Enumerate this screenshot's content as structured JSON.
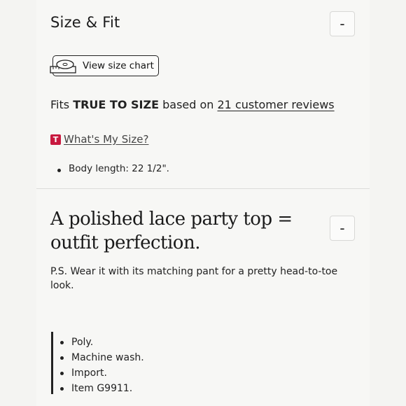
{
  "size_fit": {
    "title": "Size & Fit",
    "toggle_symbol": "-",
    "size_chart_label": "View size chart",
    "fits_prefix": "Fits ",
    "fits_value": "TRUE TO SIZE",
    "fits_middle": " based on ",
    "reviews_link": "21 customer reviews",
    "whats_my_size_badge": "T",
    "whats_my_size_label": "What's My Size?",
    "measurements": [
      "Body length: 22 1/2\"."
    ]
  },
  "details": {
    "headline": "A polished lace party top = outfit perfection.",
    "toggle_symbol": "-",
    "ps_text": "P.S. Wear it with its matching pant for a pretty head-to-toe look.",
    "features": [
      "Poly.",
      "Machine wash.",
      "Import.",
      "Item G9911."
    ]
  },
  "colors": {
    "badge": "#c8193f",
    "text": "#1a1a1a",
    "background": "#f7f7f5"
  }
}
